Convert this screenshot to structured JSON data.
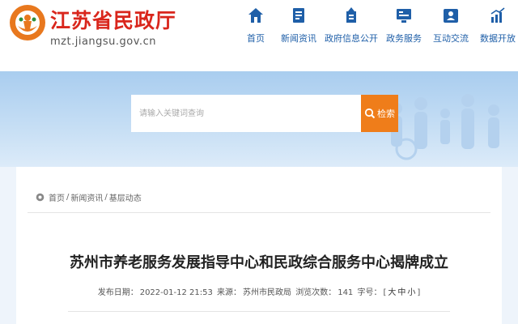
{
  "header": {
    "logo_title": "江苏省民政厅",
    "logo_domain": "mzt.jiangsu.gov.cn",
    "nav": [
      {
        "label": "首页",
        "icon": "home-icon"
      },
      {
        "label": "新闻资讯",
        "icon": "news-icon"
      },
      {
        "label": "政府信息公开",
        "icon": "info-disclosure-icon"
      },
      {
        "label": "政务服务",
        "icon": "service-icon"
      },
      {
        "label": "互动交流",
        "icon": "interaction-icon"
      },
      {
        "label": "数据开放",
        "icon": "data-chart-icon"
      }
    ],
    "accent_color": "#1f5fa8",
    "brand_color": "#d9261c"
  },
  "search": {
    "placeholder": "请输入关键词查询",
    "button_label": "检索",
    "button_color": "#ef7d1a"
  },
  "breadcrumb": {
    "items": [
      "首页",
      "新闻资讯",
      "基层动态"
    ],
    "separator": "/"
  },
  "article": {
    "title": "苏州市养老服务发展指导中心和民政综合服务中心揭牌成立",
    "meta": {
      "date_label": "发布日期：",
      "date": "2022-01-12 21:53",
      "source_label": "来源：",
      "source": "苏州市民政局",
      "views_label": "浏览次数：",
      "views": "141",
      "font_label": "字号：",
      "font_open": "[",
      "font_sizes": [
        "大",
        "中",
        "小"
      ],
      "font_close": "]"
    }
  }
}
